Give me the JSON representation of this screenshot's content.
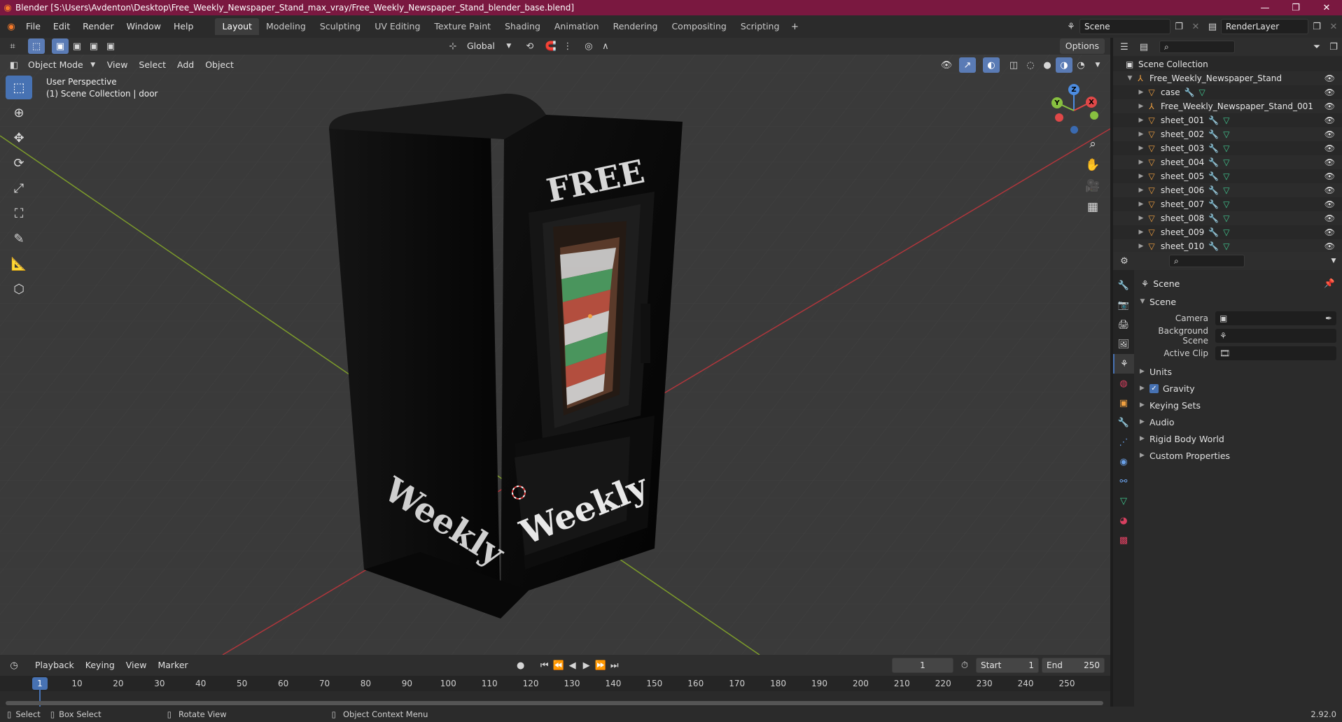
{
  "window": {
    "title": "Blender [S:\\Users\\Avdenton\\Desktop\\Free_Weekly_Newspaper_Stand_max_vray/Free_Weekly_Newspaper_Stand_blender_base.blend]",
    "minimize": "—",
    "maximize": "❐",
    "close": "✕"
  },
  "menu": [
    "File",
    "Edit",
    "Render",
    "Window",
    "Help"
  ],
  "workspaces": [
    "Layout",
    "Modeling",
    "Sculpting",
    "UV Editing",
    "Texture Paint",
    "Shading",
    "Animation",
    "Rendering",
    "Compositing",
    "Scripting"
  ],
  "active_workspace": "Layout",
  "top_right": {
    "scene": "Scene",
    "render_layer": "RenderLayer"
  },
  "viewport": {
    "mode": "Object Mode",
    "menus": [
      "View",
      "Select",
      "Add",
      "Object"
    ],
    "transform_orientation": "Global",
    "options_label": "Options",
    "overlay_line1": "User Perspective",
    "overlay_line2": "(1) Scene Collection | door",
    "model": {
      "top_text": "FREE",
      "side_text": "Weekly",
      "front_text": "Weekly"
    },
    "gizmo": {
      "x": "X",
      "y": "Y",
      "z": "Z"
    }
  },
  "timeline": {
    "menus": [
      "Playback",
      "Keying",
      "View",
      "Marker"
    ],
    "current_frame": "1",
    "start_label": "Start",
    "start": "1",
    "end_label": "End",
    "end": "250",
    "ticks": [
      "1",
      "10",
      "20",
      "30",
      "40",
      "50",
      "60",
      "70",
      "80",
      "90",
      "100",
      "110",
      "120",
      "130",
      "140",
      "150",
      "160",
      "170",
      "180",
      "190",
      "200",
      "210",
      "220",
      "230",
      "240",
      "250"
    ]
  },
  "statusbar": {
    "select": "Select",
    "box_select": "Box Select",
    "rotate_view": "Rotate View",
    "context_menu": "Object Context Menu",
    "version": "2.92.0"
  },
  "outliner": {
    "root": "Scene Collection",
    "items": [
      {
        "name": "Free_Weekly_Newspaper_Stand",
        "type": "empty",
        "indent": 1,
        "expanded": true
      },
      {
        "name": "case",
        "type": "mesh",
        "indent": 2
      },
      {
        "name": "Free_Weekly_Newspaper_Stand_001",
        "type": "empty",
        "indent": 2
      },
      {
        "name": "sheet_001",
        "type": "mesh",
        "indent": 2
      },
      {
        "name": "sheet_002",
        "type": "mesh",
        "indent": 2
      },
      {
        "name": "sheet_003",
        "type": "mesh",
        "indent": 2
      },
      {
        "name": "sheet_004",
        "type": "mesh",
        "indent": 2
      },
      {
        "name": "sheet_005",
        "type": "mesh",
        "indent": 2
      },
      {
        "name": "sheet_006",
        "type": "mesh",
        "indent": 2
      },
      {
        "name": "sheet_007",
        "type": "mesh",
        "indent": 2
      },
      {
        "name": "sheet_008",
        "type": "mesh",
        "indent": 2
      },
      {
        "name": "sheet_009",
        "type": "mesh",
        "indent": 2
      },
      {
        "name": "sheet_010",
        "type": "mesh",
        "indent": 2
      }
    ]
  },
  "properties": {
    "breadcrumb": "Scene",
    "panel_title": "Scene",
    "fields": [
      {
        "label": "Camera"
      },
      {
        "label": "Background Scene"
      },
      {
        "label": "Active Clip"
      }
    ],
    "sub_panels": [
      "Units",
      "Gravity",
      "Keying Sets",
      "Audio",
      "Rigid Body World",
      "Custom Properties"
    ],
    "gravity_checked": true
  },
  "colors": {
    "accent": "#4772b3",
    "titlebar": "#7a1840",
    "x_axis": "#e04848",
    "y_axis": "#88c040",
    "z_axis": "#4c8ce0",
    "mesh_icon": "#f0a040"
  }
}
